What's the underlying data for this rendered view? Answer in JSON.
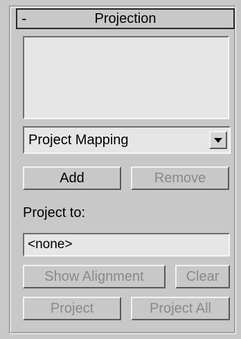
{
  "rollout": {
    "collapse_symbol": "-",
    "title": "Projection"
  },
  "dropdown": {
    "selected": "Project Mapping",
    "arrow_icon": "chevron-down-icon"
  },
  "buttons": {
    "add": "Add",
    "remove": "Remove",
    "show_alignment": "Show Alignment",
    "clear": "Clear",
    "project": "Project",
    "project_all": "Project All"
  },
  "project_to": {
    "label": "Project to:",
    "value": "<none>"
  },
  "colors": {
    "panel_bg": "#c8c8c8",
    "field_bg": "#e6e6e6",
    "disabled_text": "#8a8a8a"
  }
}
